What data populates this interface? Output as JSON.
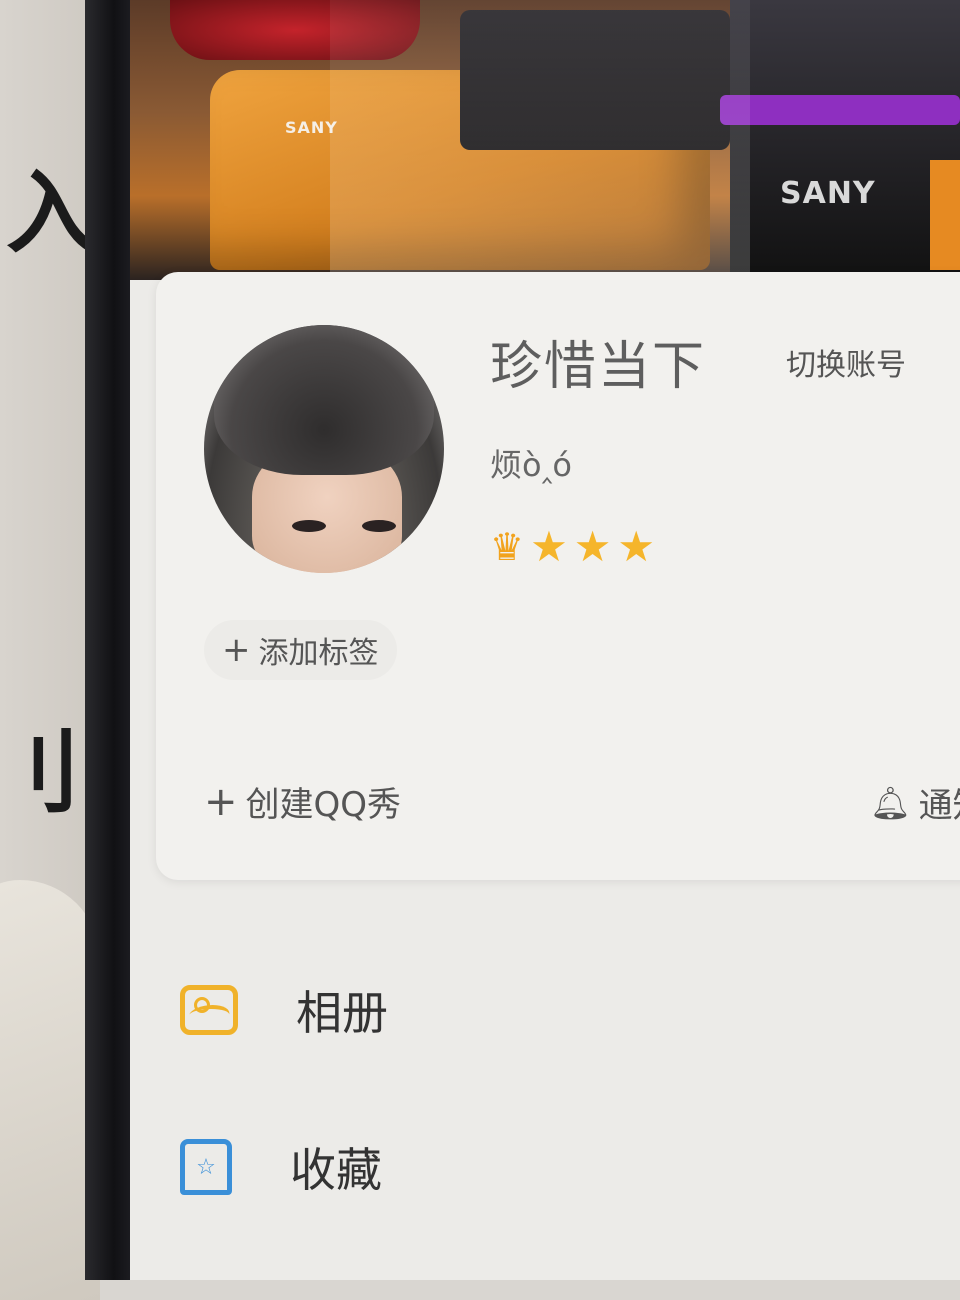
{
  "profile": {
    "nickname": "珍惜⁣当下",
    "switch_account_label": "切换账号",
    "signature": "烦ò‸ó",
    "level_icons": [
      "crown-icon",
      "star-icon",
      "star-icon",
      "star-icon"
    ],
    "add_tag_label": "添加标签"
  },
  "actions": {
    "create_qq_show_label": "创建QQ秀",
    "notify_label": "通知"
  },
  "menu": {
    "items": [
      {
        "label": "相册",
        "icon": "album-icon"
      },
      {
        "label": "收藏",
        "icon": "favorites-icon"
      }
    ]
  },
  "cover": {
    "brand_text_1": "SANY",
    "brand_text_2": "SANY"
  },
  "colors": {
    "accent_gold": "#f0b22a",
    "accent_blue": "#3a8fd8"
  }
}
